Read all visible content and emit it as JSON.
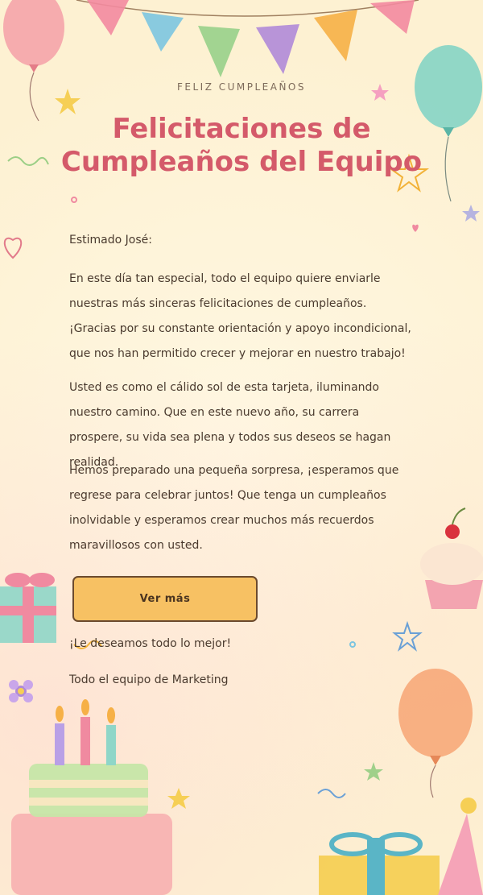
{
  "card": {
    "eyebrow": "FELIZ CUMPLEAÑOS",
    "title_line1": "Felicitaciones de",
    "title_line2": "Cumpleaños del Equipo",
    "salutation": "Estimado José:",
    "paragraphs": [
      "En este día tan especial, todo el equipo quiere enviarle nuestras más sinceras felicitaciones de cumpleaños. ¡Gracias por su constante orientación y apoyo incondicional, que nos han permitido crecer y mejorar en nuestro trabajo!",
      "Usted es como el cálido sol de esta tarjeta, iluminando nuestro camino. Que en este nuevo año, su carrera prospere, su vida sea plena y todos sus deseos se hagan realidad.",
      "Hemos preparado una pequeña sorpresa, ¡esperamos que regrese para celebrar juntos! Que tenga un cumpleaños inolvidable y esperamos crear muchos más recuerdos maravillosos con usted."
    ],
    "button_label": "Ver más",
    "closing": "¡Le deseamos todo lo mejor!",
    "signature": "Todo el equipo de Marketing"
  },
  "colors": {
    "background": "#fdf3d6",
    "title": "#d45a6a",
    "button": "#f7c163",
    "text": "#4a3a2e"
  },
  "icons": [
    "bunting-flags",
    "balloon-pink",
    "balloon-teal",
    "balloon-orange",
    "birthday-cake",
    "cupcake",
    "gift-box",
    "party-hat",
    "star",
    "heart",
    "flower",
    "confetti"
  ]
}
